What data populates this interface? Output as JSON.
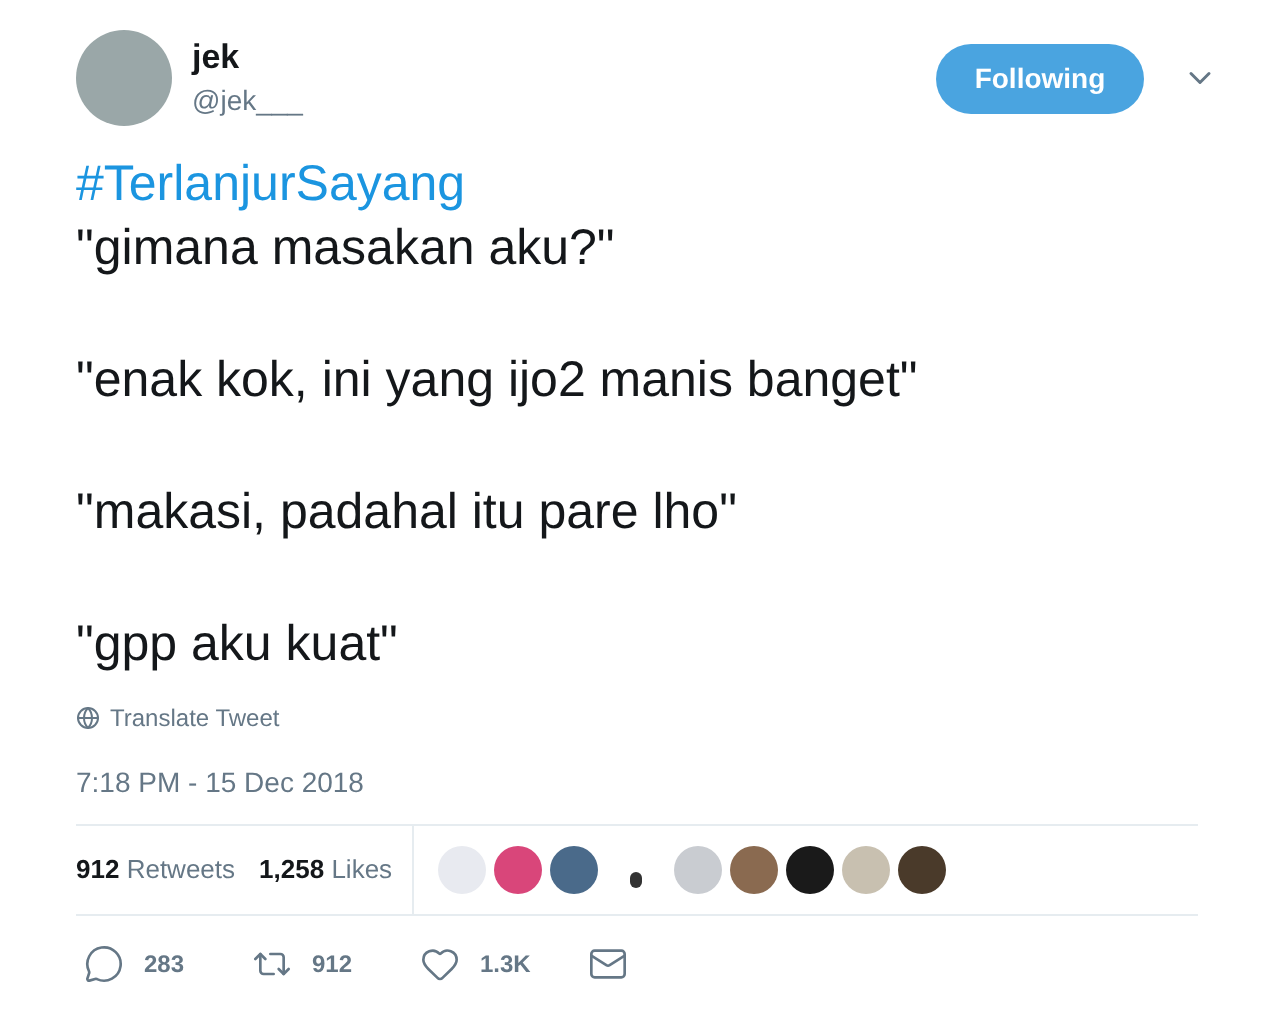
{
  "author": {
    "name": "jek",
    "handle": "@jek___"
  },
  "follow_button": {
    "label": "Following"
  },
  "hashtag": "#TerlanjurSayang",
  "body": [
    "\"gimana masakan aku?\"",
    "\"enak kok, ini yang ijo2 manis banget\"",
    "\"makasi, padahal itu pare lho\"",
    "\"gpp aku kuat\""
  ],
  "translate_link": "Translate Tweet",
  "timestamp": "7:18 PM - 15 Dec 2018",
  "stats": [
    {
      "count": "912",
      "label": "Retweets"
    },
    {
      "count": "1,258",
      "label": "Likes"
    }
  ],
  "actions": [
    {
      "kind": "reply",
      "count": "283"
    },
    {
      "kind": "retweet",
      "count": "912"
    },
    {
      "kind": "like",
      "count": "1.3K"
    },
    {
      "kind": "message"
    }
  ]
}
